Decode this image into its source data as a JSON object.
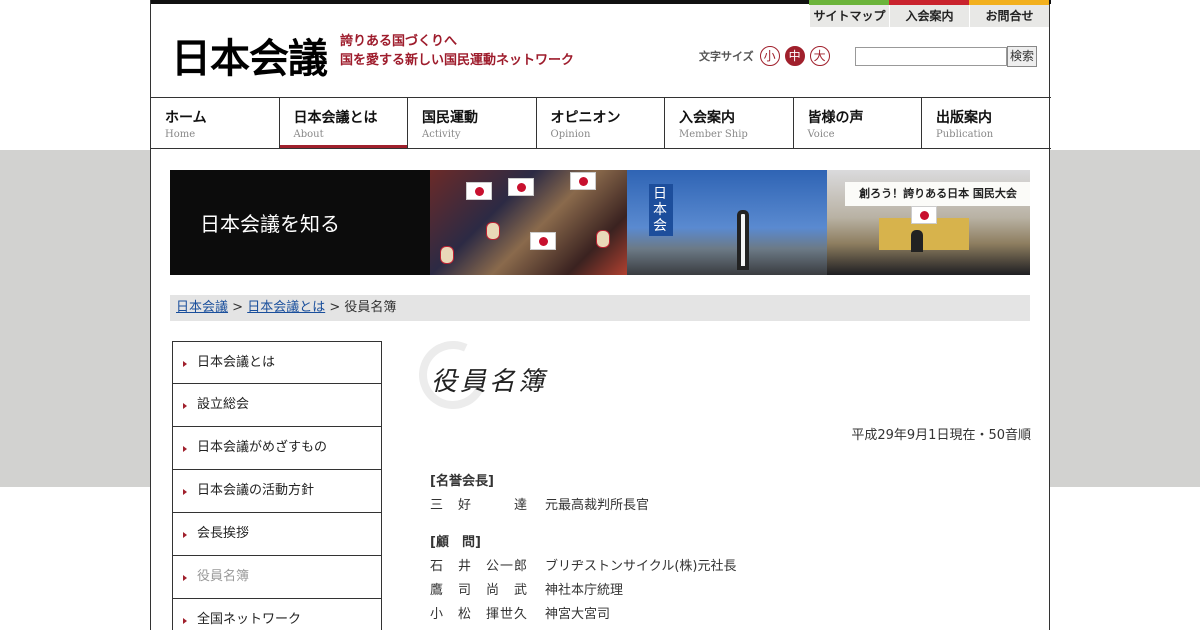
{
  "header": {
    "logo": "日本会議",
    "tagline_1": "誇りある国づくりへ",
    "tagline_2": "国を愛する新しい国民運動ネットワーク",
    "util_nav": [
      "サイトマップ",
      "入会案内",
      "お問合せ"
    ],
    "colors": [
      "#6bb33a",
      "#c9232d",
      "#f2b01e"
    ],
    "font_size_label": "文字サイズ",
    "font_sizes": [
      "小",
      "中",
      "大"
    ],
    "font_size_selected": "中",
    "search_placeholder": "",
    "search_button": "検索"
  },
  "global_nav": [
    {
      "jp": "ホーム",
      "en": "Home"
    },
    {
      "jp": "日本会議とは",
      "en": "About",
      "active": true
    },
    {
      "jp": "国民運動",
      "en": "Activity"
    },
    {
      "jp": "オピニオン",
      "en": "Opinion"
    },
    {
      "jp": "入会案内",
      "en": "Member Ship"
    },
    {
      "jp": "皆様の声",
      "en": "Voice"
    },
    {
      "jp": "出版案内",
      "en": "Publication"
    }
  ],
  "banner": {
    "title": "日本会議を知る",
    "sign_text": "創ろう！誇りある日本 国民大会",
    "photo_text": "日本会"
  },
  "breadcrumb": {
    "crumb_1": "日本会議",
    "sep_1": " > ",
    "crumb_2": "日本会議とは",
    "sep_2": " > ",
    "current": "役員名簿"
  },
  "sidebar": [
    {
      "label": "日本会議とは"
    },
    {
      "label": "設立総会"
    },
    {
      "label": "日本会議がめざすもの"
    },
    {
      "label": "日本会議の活動方針"
    },
    {
      "label": "会長挨拶"
    },
    {
      "label": "役員名簿",
      "current": true
    },
    {
      "label": "全国ネットワーク"
    }
  ],
  "main": {
    "heading": "役員名簿",
    "as_of": "平成29年9月1日現在・50音順",
    "sections": [
      {
        "title": "[名誉会長]",
        "members": [
          {
            "name": "三　好　　　達",
            "title": "元最高裁判所長官"
          }
        ]
      },
      {
        "title": "[顧　問]",
        "members": [
          {
            "name": "石　井　公一郎",
            "title": "ブリヂストンサイクル(株)元社長"
          },
          {
            "name": "鷹　司　尚　武",
            "title": "神社本庁統理"
          },
          {
            "name": "小　松　揮世久",
            "title": "神宮大宮司"
          }
        ]
      }
    ]
  }
}
